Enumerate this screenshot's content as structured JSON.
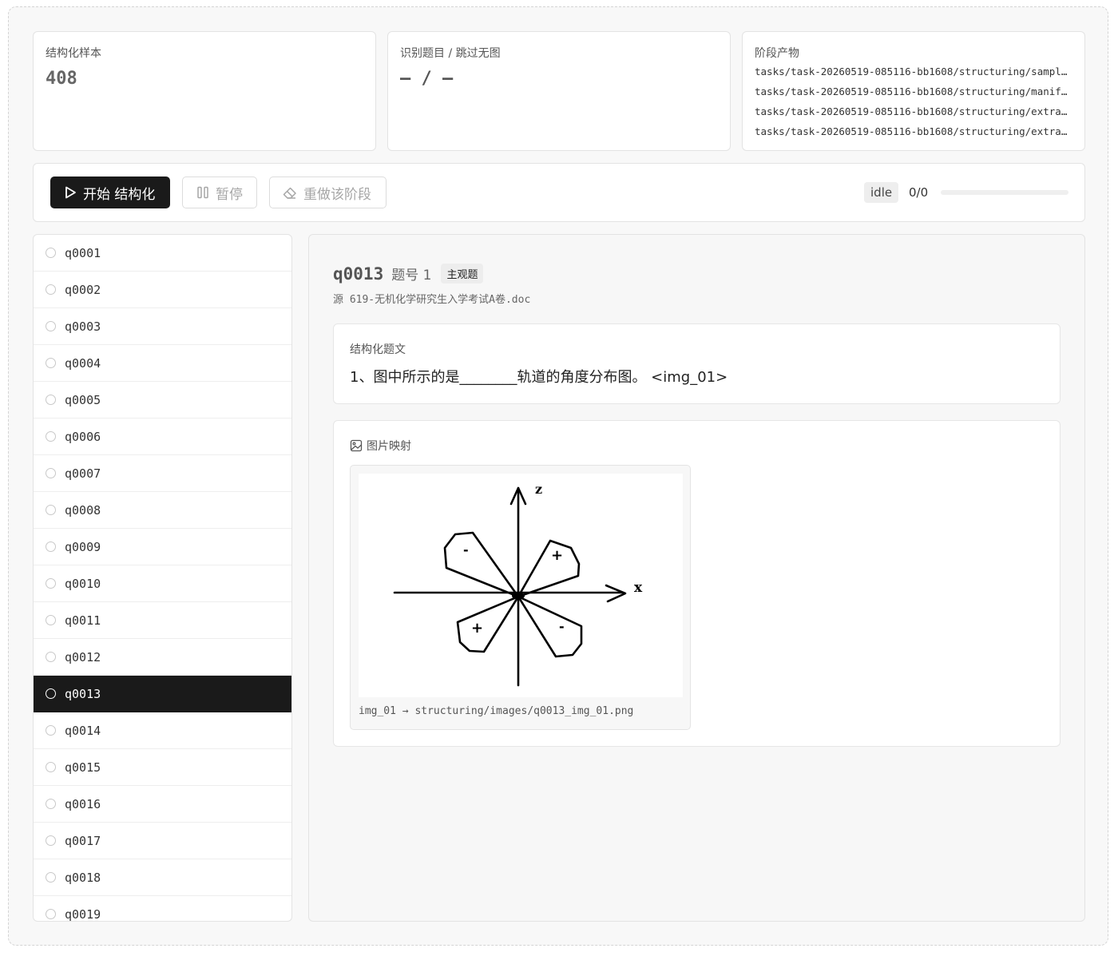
{
  "stats": {
    "samples": {
      "label": "结构化样本",
      "value": "408"
    },
    "recognized": {
      "label": "识别题目 / 跳过无图",
      "value": "— / —"
    },
    "artifacts": {
      "label": "阶段产物",
      "paths": [
        "tasks/task-20260519-085116-bb1608/structuring/samples.jsonl",
        "tasks/task-20260519-085116-bb1608/structuring/manifest.json",
        "tasks/task-20260519-085116-bb1608/structuring/extracted.json",
        "tasks/task-20260519-085116-bb1608/structuring/extra_images.json"
      ]
    }
  },
  "toolbar": {
    "start_label": "开始 结构化",
    "pause_label": "暂停",
    "redo_label": "重做该阶段",
    "status": "idle",
    "progress_text": "0/0",
    "progress_fraction": 0
  },
  "questions": [
    "q0001",
    "q0002",
    "q0003",
    "q0004",
    "q0005",
    "q0006",
    "q0007",
    "q0008",
    "q0009",
    "q0010",
    "q0011",
    "q0012",
    "q0013",
    "q0014",
    "q0015",
    "q0016",
    "q0017",
    "q0018",
    "q0019"
  ],
  "selected_question": "q0013",
  "detail": {
    "id": "q0013",
    "number_label": "题号 1",
    "type_badge": "主观题",
    "source": "源 619-无机化学研究生入学考试A卷.doc",
    "stem_label": "结构化题文",
    "stem_text": "1、图中所示的是________轨道的角度分布图。 <img_01>",
    "images_label": "图片映射",
    "image_caption": "img_01 → structuring/images/q0013_img_01.png",
    "figure": {
      "x_label": "x",
      "z_label": "z",
      "lobe_signs": [
        "-",
        "+",
        "+",
        "-"
      ]
    }
  }
}
